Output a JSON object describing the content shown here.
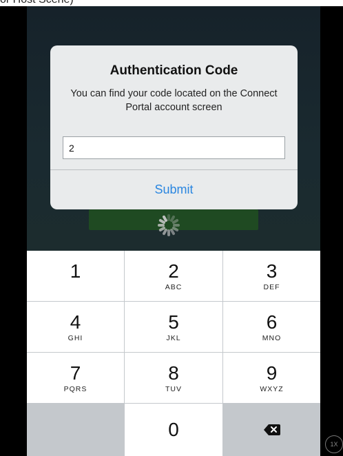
{
  "caption": "or Host Scene)",
  "dialog": {
    "title": "Authentication Code",
    "message": "You can find your code located on the Connect Portal account screen",
    "input_value": "2",
    "submit_label": "Submit"
  },
  "keypad": {
    "keys": [
      {
        "digit": "1",
        "letters": ""
      },
      {
        "digit": "2",
        "letters": "ABC"
      },
      {
        "digit": "3",
        "letters": "DEF"
      },
      {
        "digit": "4",
        "letters": "GHI"
      },
      {
        "digit": "5",
        "letters": "JKL"
      },
      {
        "digit": "6",
        "letters": "MNO"
      },
      {
        "digit": "7",
        "letters": "PQRS"
      },
      {
        "digit": "8",
        "letters": "TUV"
      },
      {
        "digit": "9",
        "letters": "WXYZ"
      },
      {
        "digit": "0",
        "letters": ""
      }
    ],
    "backspace_icon": "backspace-icon"
  },
  "zoom_badge": "1X",
  "colors": {
    "accent": "#2a86e0",
    "keypad_bg": "#c4c8cc",
    "dialog_bg": "#e9ebec"
  }
}
